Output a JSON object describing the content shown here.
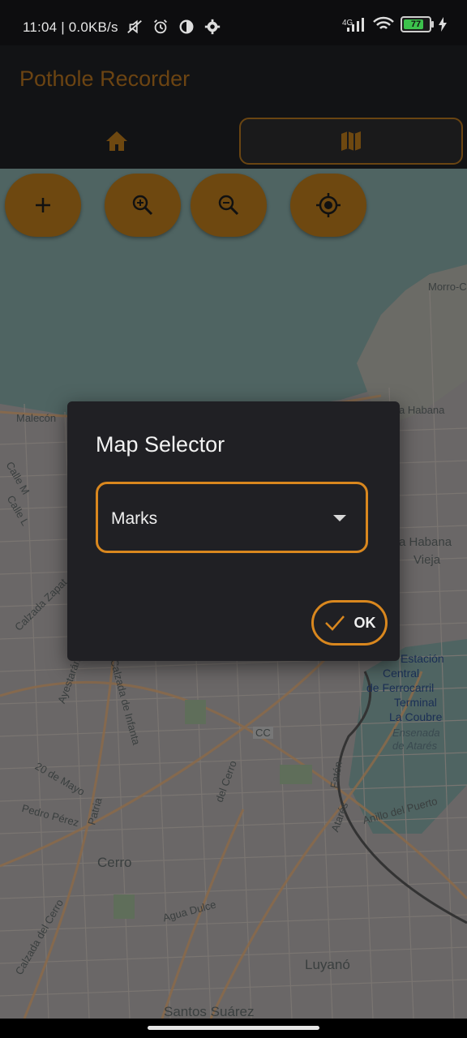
{
  "status": {
    "time": "11:04 | 0.0KB/s",
    "network": "4G",
    "battery": "77",
    "icons": [
      "mute-icon",
      "alarm-icon",
      "data-saver-icon",
      "settings-icon",
      "signal-icon",
      "wifi-icon",
      "battery-icon",
      "charging-icon"
    ]
  },
  "appbar": {
    "title": "Pothole Recorder",
    "tabs": [
      {
        "name": "home",
        "icon": "home-icon"
      },
      {
        "name": "map",
        "icon": "map-icon",
        "selected": true
      }
    ]
  },
  "map": {
    "controls": [
      {
        "name": "add",
        "icon": "plus-icon"
      },
      {
        "name": "zoom-in",
        "icon": "zoom-in-icon"
      },
      {
        "name": "zoom-out",
        "icon": "zoom-out-icon"
      },
      {
        "name": "locate",
        "icon": "crosshair-icon"
      }
    ],
    "labels": {
      "morro": "Morro-C",
      "habana": "a Habana",
      "malecon": "Malecón",
      "habana_vieja_1": "a Habana",
      "habana_vieja_2": "Vieja",
      "estacion_1": "Estación",
      "estacion_2": "Central",
      "estacion_3": "de Ferrocarril",
      "estacion_4": "Terminal",
      "estacion_5": "La Coubre",
      "ensenada_1": "Ensenada",
      "ensenada_2": "de Atarés",
      "calzada_zapata": "Calzada Zapat",
      "calle_l": "Calle L",
      "calle_m": "Calle M",
      "ayestaran": "Ayestarán",
      "infanta": "Calzada de Infanta",
      "veinte_mayo": "20 de Mayo",
      "pedro_perez": "Pedro Pérez",
      "patria": "Patria",
      "cerro": "Cerro",
      "calzada_cerro": "Calzada del Cerro",
      "cerro_calzada2": "del Cerro",
      "agua_dulce": "Agua Dulce",
      "cc": "CC",
      "anillo": "Anillo del Puerto",
      "atares": "Atarés",
      "luyano": "Luyanó",
      "santos_suarez": "Santos Suárez",
      "faton": "Fatón"
    },
    "colors": {
      "water": "#4f6462",
      "land": "#6a6868",
      "street": "#7a7673"
    }
  },
  "dialog": {
    "title": "Map Selector",
    "select_value": "Marks",
    "ok_label": "OK"
  },
  "colors": {
    "accent": "#d9871e",
    "fab": "#6e4810",
    "dialog_bg": "#202024"
  }
}
